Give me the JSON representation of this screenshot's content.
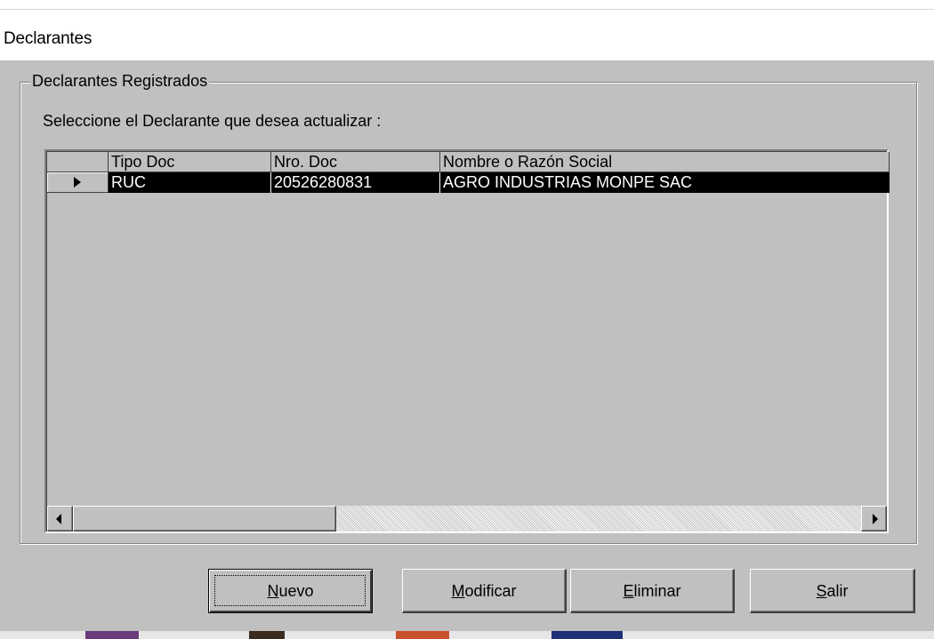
{
  "window": {
    "title": "Declarantes"
  },
  "group": {
    "legend": "Declarantes Registrados"
  },
  "prompt": "Seleccione el Declarante que desea actualizar :",
  "grid": {
    "columns": [
      "Tipo Doc",
      "Nro. Doc",
      "Nombre o Razón Social"
    ],
    "rows": [
      {
        "tipo": "RUC",
        "nro": "20526280831",
        "nombre": "AGRO INDUSTRIAS MONPE SAC",
        "selected": true
      }
    ]
  },
  "buttons": {
    "nuevo": {
      "mnemonic": "N",
      "rest": "uevo"
    },
    "modificar": {
      "mnemonic": "M",
      "rest": "odificar"
    },
    "eliminar": {
      "mnemonic": "E",
      "rest": "liminar"
    },
    "salir": {
      "mnemonic": "S",
      "rest": "alir"
    }
  }
}
